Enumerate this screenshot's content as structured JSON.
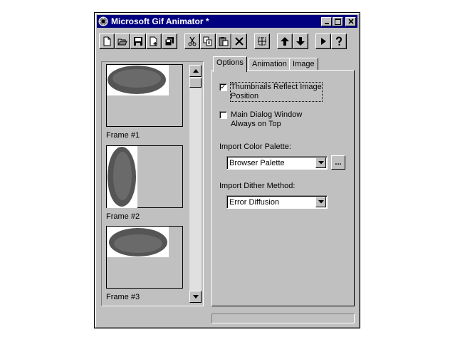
{
  "window": {
    "title": "Microsoft Gif Animator *"
  },
  "title_buttons": {
    "minimize": "_",
    "maximize": "□",
    "close": "✕"
  },
  "toolbar": {
    "items": [
      "new-icon",
      "open-icon",
      "save-icon",
      "insert-icon",
      "save-as-icon",
      "cut-icon",
      "copy-icon",
      "paste-icon",
      "delete-icon",
      "select-all-icon",
      "move-up-icon",
      "move-down-icon",
      "play-icon",
      "help-icon"
    ]
  },
  "frames": [
    {
      "label": "Frame #1"
    },
    {
      "label": "Frame #2"
    },
    {
      "label": "Frame #3"
    }
  ],
  "tabs": [
    {
      "label": "Options",
      "active": true
    },
    {
      "label": "Animation",
      "active": false
    },
    {
      "label": "Image",
      "active": false
    }
  ],
  "options": {
    "thumbnails": {
      "line1": "Thumbnails Reflect Image",
      "line2": "Position",
      "checked": true
    },
    "main_dialog": {
      "line1": "Main Dialog Window",
      "line2": "Always on Top",
      "checked": false
    },
    "palette_label": "Import Color Palette:",
    "palette_value": "Browser Palette",
    "palette_button": "...",
    "dither_label": "Import Dither Method:",
    "dither_value": "Error Diffusion"
  },
  "check_mark": "✓"
}
